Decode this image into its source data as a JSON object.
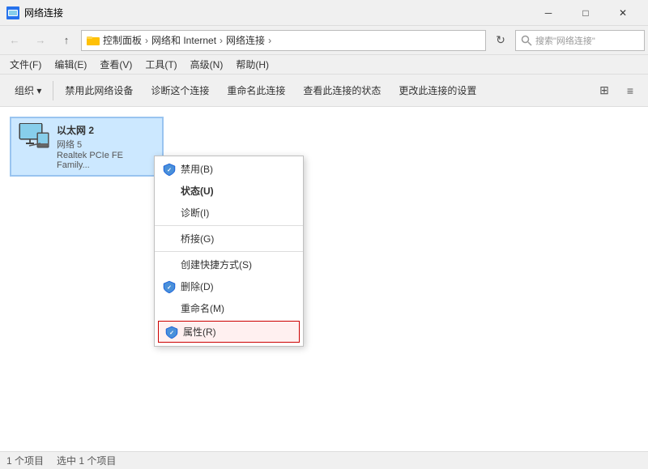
{
  "titlebar": {
    "title": "网络连接",
    "min_label": "─",
    "max_label": "□",
    "close_label": "✕"
  },
  "addressbar": {
    "back_icon": "←",
    "forward_icon": "→",
    "up_icon": "↑",
    "breadcrumb": [
      "控制面板",
      "网络和 Internet",
      "网络连接"
    ],
    "breadcrumb_sep": "›",
    "search_placeholder": "搜索\"网络连接\"",
    "refresh_icon": "↻"
  },
  "menubar": {
    "items": [
      "文件(F)",
      "编辑(E)",
      "查看(V)",
      "工具(T)",
      "高级(N)",
      "帮助(H)"
    ]
  },
  "toolbar": {
    "organize": "组织 ▾",
    "disable": "禁用此网络设备",
    "diagnose": "诊断这个连接",
    "rename": "重命名此连接",
    "view_status": "查看此连接的状态",
    "change_settings": "更改此连接的设置",
    "view_icon": "≡",
    "sort_icon": "⊞"
  },
  "adapter": {
    "name": "以太网 2",
    "network": "网络 5",
    "driver": "Realtek PCIe FE Family..."
  },
  "context_menu": {
    "items": [
      {
        "label": "禁用(B)",
        "shield": true,
        "bold": false
      },
      {
        "label": "状态(U)",
        "shield": false,
        "bold": true
      },
      {
        "label": "诊断(I)",
        "shield": false,
        "bold": false
      },
      {
        "label": "separator"
      },
      {
        "label": "桥接(G)",
        "shield": false,
        "bold": false
      },
      {
        "label": "separator"
      },
      {
        "label": "创建快捷方式(S)",
        "shield": false,
        "bold": false
      },
      {
        "label": "删除(D)",
        "shield": true,
        "bold": false
      },
      {
        "label": "重命名(M)",
        "shield": false,
        "bold": false
      },
      {
        "label": "属性(R)",
        "shield": true,
        "bold": false,
        "highlighted": true
      }
    ]
  },
  "statusbar": {
    "count": "1 个项目",
    "selected": "选中 1 个项目"
  }
}
